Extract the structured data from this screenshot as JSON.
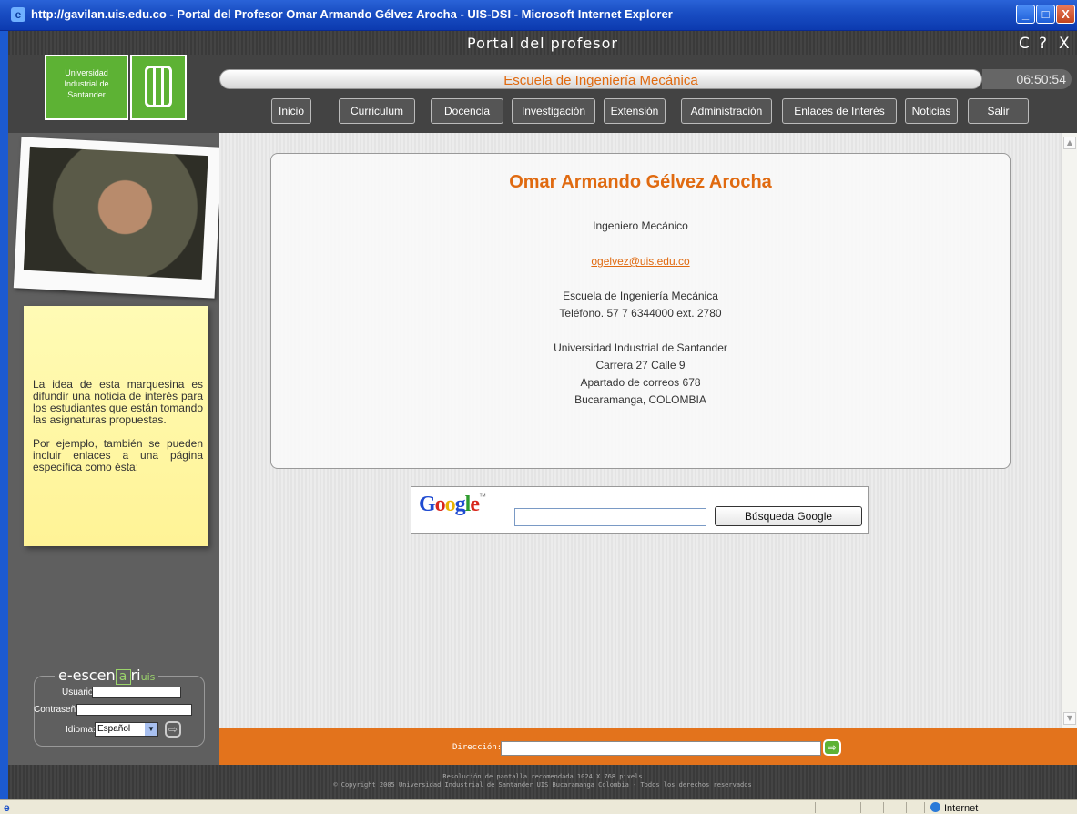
{
  "window": {
    "title": "http://gavilan.uis.edu.co - Portal del Profesor Omar Armando Gélvez Arocha - UIS-DSI - Microsoft Internet Explorer",
    "min_label": "_",
    "max_label": "□",
    "close_label": "X"
  },
  "portal": {
    "title": "Portal del profesor",
    "controls": [
      "C",
      "?",
      "X"
    ],
    "logo_text": [
      "Universidad",
      "Industrial de",
      "Santander"
    ],
    "school": "Escuela de Ingeniería Mecánica",
    "clock": "06:50:54"
  },
  "nav": {
    "items": [
      "Inicio",
      "Curriculum",
      "Docencia",
      "Investigación",
      "Extensión",
      "Administración",
      "Enlaces de Interés",
      "Noticias",
      "Salir"
    ]
  },
  "marquee": {
    "p1": "La idea de esta marquesina es difundir una noticia de interés para los estudiantes que están tomando las asignaturas propuestas.",
    "p2": "Por ejemplo, también se pueden incluir enlaces a una página específica como ésta:"
  },
  "login": {
    "brand_pre": "e-escen",
    "brand_a": "a",
    "brand_ri": "ri",
    "brand_uis": "uis",
    "user_label": "Usuario:",
    "password_label": "Contraseña:",
    "language_label": "Idioma:",
    "language_value": "Español"
  },
  "profile": {
    "name": "Omar Armando Gélvez Arocha",
    "profession": "Ingeniero Mecánico",
    "email": "ogelvez@uis.edu.co",
    "department": "Escuela de Ingeniería Mecánica",
    "phone": "Teléfono.  57 7 6344000 ext. 2780",
    "university": "Universidad Industrial de Santander",
    "street": "Carrera 27 Calle 9",
    "po_box": "Apartado de correos 678",
    "city": "Bucaramanga, COLOMBIA"
  },
  "google": {
    "logo": "Google",
    "tm": "™",
    "button": "Búsqueda Google"
  },
  "address": {
    "label": "Dirección:"
  },
  "footer": {
    "line1": "Resolución de pantalla recomendada 1024 X 768 pixels",
    "line2": "© Copyright 2005 Universidad Industrial de Santander UIS Bucaramanga Colombia - Todos los derechos reservados"
  },
  "status": {
    "zone": "Internet"
  },
  "colors": {
    "accent": "#e06a10",
    "brand_green": "#5db234",
    "address_bar": "#e3731c"
  }
}
